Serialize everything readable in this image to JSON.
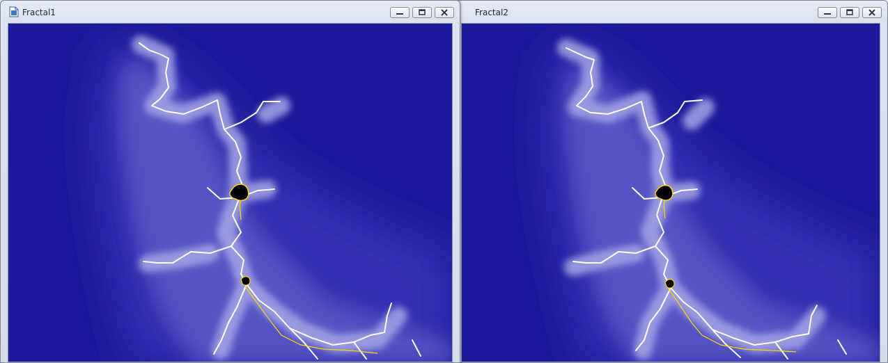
{
  "windows": [
    {
      "title": "Fractal1",
      "icon": "document-icon",
      "active": true
    },
    {
      "title": "Fractal2",
      "icon": "document-icon",
      "active": false
    }
  ],
  "controls": {
    "minimize_icon": "minimize-icon",
    "restore_icon": "restore-icon",
    "close_icon": "close-icon"
  },
  "fractal": {
    "kind": "julia-set",
    "colors": {
      "background": "#1a1a9a",
      "mid": "#3535b5",
      "glow": "#9a9ae0",
      "filament": "#ffffff",
      "core": "#ffd700",
      "center": "#000000"
    }
  }
}
